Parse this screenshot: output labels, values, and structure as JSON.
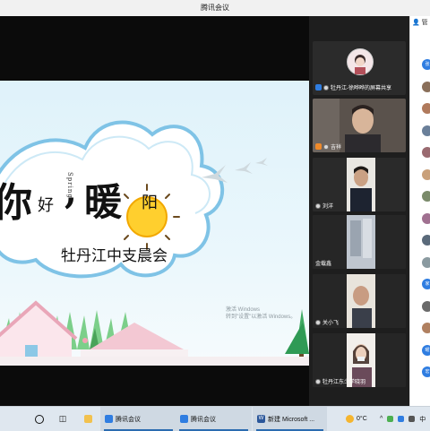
{
  "window": {
    "title": "腾讯会议"
  },
  "slide": {
    "char1": "你",
    "char2": "好",
    "char3": "暖",
    "char4": "阳",
    "comma": ",",
    "spring": "Spring",
    "subtitle": "牡丹江中支晨会"
  },
  "watermark": {
    "line1": "激活 Windows",
    "line2": "转到\"设置\"以激活 Windows。"
  },
  "participants": [
    {
      "name": "牡丹江-徐晔晔的屏幕共享"
    },
    {
      "name": "吉祥"
    },
    {
      "name": "刘洋"
    },
    {
      "name": "金载鑫"
    },
    {
      "name": "关小飞"
    },
    {
      "name": "牡丹江东少学晓羽"
    }
  ],
  "sidebar": {
    "header_label": "管",
    "avatars": [
      {
        "text": "张",
        "color": "#2f7de1"
      },
      {
        "text": "",
        "color": "#8a6f5a"
      },
      {
        "text": "",
        "color": "#b07a5c"
      },
      {
        "text": "",
        "color": "#6a7f99"
      },
      {
        "text": "",
        "color": "#9a6a70"
      },
      {
        "text": "",
        "color": "#c9a07a"
      },
      {
        "text": "",
        "color": "#7a8a6a"
      },
      {
        "text": "",
        "color": "#a07090"
      },
      {
        "text": "",
        "color": "#5a6a7a"
      },
      {
        "text": "",
        "color": "#8a9aa0"
      },
      {
        "text": "家",
        "color": "#2f7de1"
      },
      {
        "text": "",
        "color": "#6a6a6a"
      },
      {
        "text": "",
        "color": "#b08060"
      },
      {
        "text": "曜",
        "color": "#2f7de1"
      },
      {
        "text": "宏",
        "color": "#2f7de1"
      }
    ]
  },
  "taskbar": {
    "app1": "腾讯会议",
    "app2": "腾讯会议",
    "app3": "新建 Microsoft ...",
    "temp": "0°C",
    "lang": "中"
  }
}
